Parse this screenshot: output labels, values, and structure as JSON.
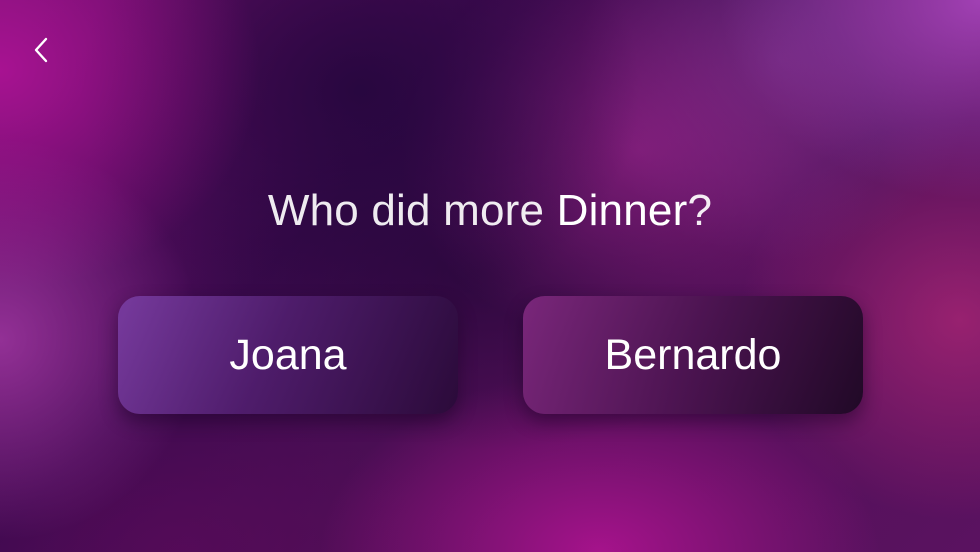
{
  "screen": {
    "back_icon": "chevron-left-icon",
    "colors": {
      "background_primary": "#4f0f56",
      "background_accent": "#be14a0",
      "text": "#ffffff"
    }
  },
  "question": {
    "prefix": "Who did more ",
    "highlight": "Dinner",
    "suffix": "?"
  },
  "options": [
    {
      "label": "Joana"
    },
    {
      "label": "Bernardo"
    }
  ]
}
